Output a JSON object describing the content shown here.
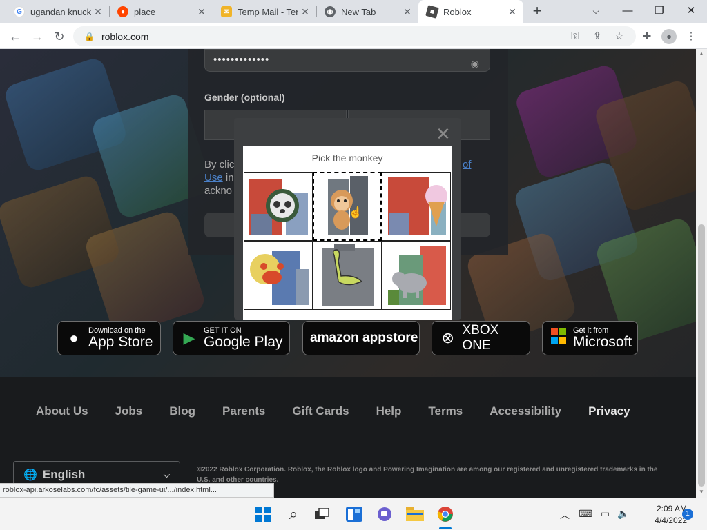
{
  "browser": {
    "tabs": [
      {
        "title": "ugandan knuckl",
        "icon": "google-icon",
        "color": "#4285f4"
      },
      {
        "title": "place",
        "icon": "reddit-icon",
        "color": "#ff4500"
      },
      {
        "title": "Temp Mail - Ten",
        "icon": "mail-icon",
        "color": "#f0b429"
      },
      {
        "title": "New Tab",
        "icon": "chrome-icon",
        "color": "#5f6368"
      },
      {
        "title": "Roblox",
        "icon": "roblox-icon",
        "color": "#4a4a4a"
      }
    ],
    "url": "roblox.com"
  },
  "form": {
    "password_mask": "•••••••••••••",
    "gender_label": "Gender (optional)",
    "legal_prefix": "By clic",
    "legal_link_tail": "of",
    "legal_line2_link": "Use",
    "legal_line2": " in",
    "legal_line3": "ackno"
  },
  "captcha": {
    "prompt": "Pick the monkey",
    "tiles": [
      "raccoon",
      "monkey",
      "ice-cream",
      "crab",
      "dinosaur",
      "elephant"
    ],
    "selected_index": 1
  },
  "stores": [
    {
      "small": "Download on the",
      "big": "App Store",
      "icon": "apple-icon"
    },
    {
      "small": "GET IT ON",
      "big": "Google Play",
      "icon": "google-play-icon"
    },
    {
      "small": "",
      "big": "amazon appstore",
      "icon": ""
    },
    {
      "small": "",
      "big": "XBOX ONE",
      "icon": "xbox-icon"
    },
    {
      "small": "Get it from",
      "big": "Microsoft",
      "icon": "microsoft-icon"
    }
  ],
  "footer": {
    "links": [
      "About Us",
      "Jobs",
      "Blog",
      "Parents",
      "Gift Cards",
      "Help",
      "Terms",
      "Accessibility",
      "Privacy"
    ],
    "language": "English",
    "copyright": "©2022 Roblox Corporation. Roblox, the Roblox logo and Powering Imagination are among our registered and unregistered trademarks in the U.S. and other countries."
  },
  "status_url": "roblox-api.arkoselabs.com/fc/assets/tile-game-ui/.../index.html...",
  "taskbar": {
    "time": "2:09 AM",
    "date": "4/4/2022",
    "notifications": "1"
  }
}
